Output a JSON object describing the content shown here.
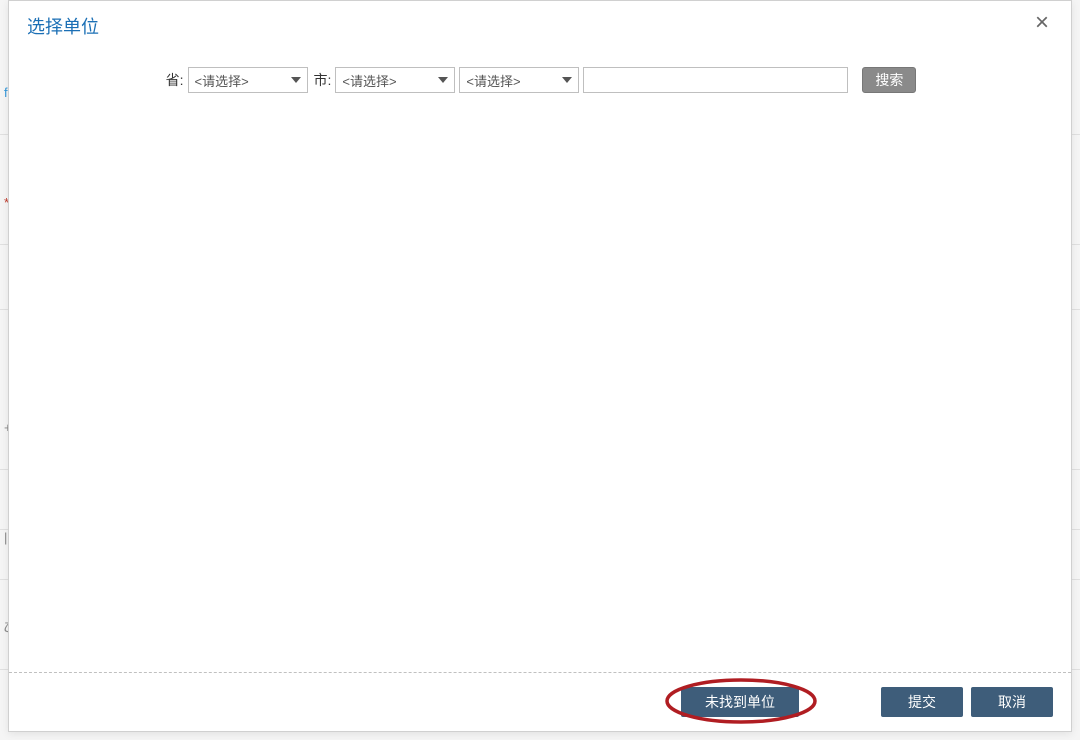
{
  "modal": {
    "title": "选择单位",
    "close_label": "×"
  },
  "filters": {
    "province_label": "省:",
    "province_placeholder": "<请选择>",
    "city_label": "市:",
    "city_placeholder": "<请选择>",
    "district_placeholder": "<请选择>",
    "keyword_value": "",
    "search_label": "搜索"
  },
  "footer": {
    "not_found_label": "未找到单位",
    "submit_label": "提交",
    "cancel_label": "取消"
  },
  "colors": {
    "accent": "#1b6fb5",
    "button": "#3e5d7a",
    "highlight_ring": "#b01d22"
  }
}
